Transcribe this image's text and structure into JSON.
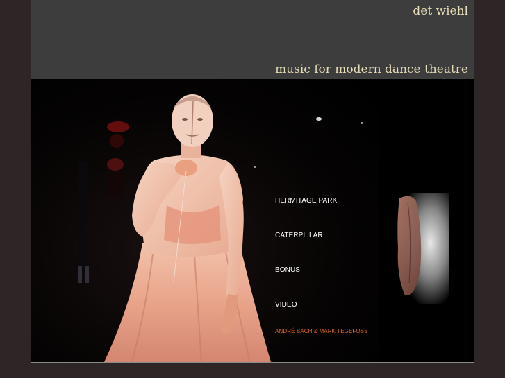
{
  "header": {
    "site_title": "det wiehl",
    "tagline": "music for modern dance theatre"
  },
  "nav": {
    "items": [
      {
        "label": "HERMITAGE PARK"
      },
      {
        "label": "CATERPILLAR"
      },
      {
        "label": "BONUS"
      },
      {
        "label": "VIDEO"
      }
    ],
    "credit": "ANDRÉ BACH & MARK TEGEFOSS"
  },
  "colors": {
    "page_background": "#2e2626",
    "header_background": "#3d3d3d",
    "title_text": "#e6dcb8",
    "nav_text": "#ffffff",
    "credit_text": "#d96a1e"
  },
  "images": {
    "main": "dancer-photo",
    "side": "fabric-thumbnail"
  }
}
